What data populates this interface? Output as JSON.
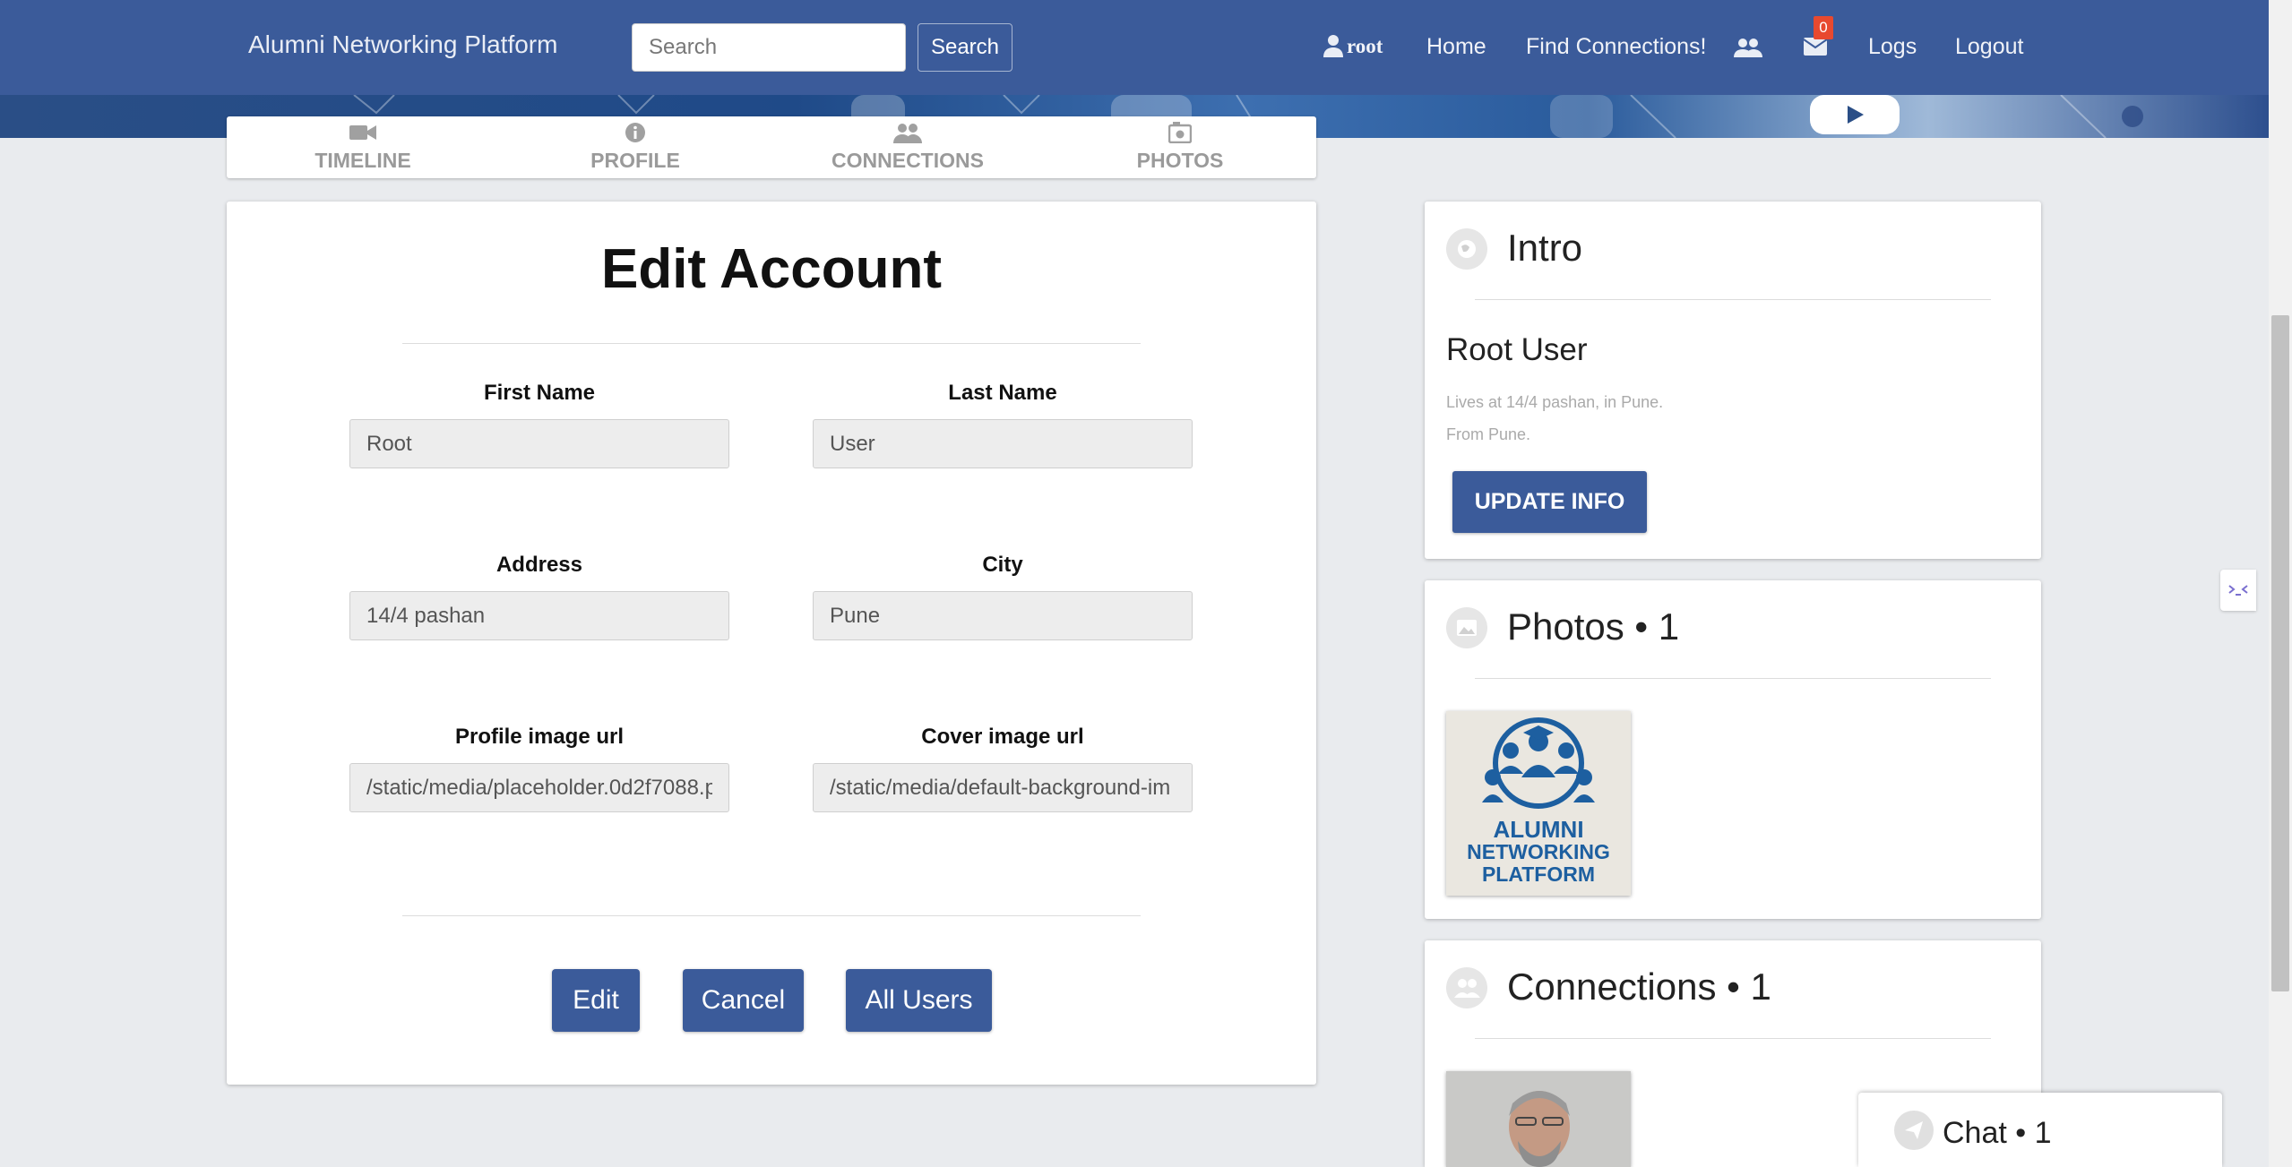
{
  "navbar": {
    "brand": "Alumni Networking Platform",
    "search_placeholder": "Search",
    "search_button": "Search",
    "user": "root",
    "home": "Home",
    "find": "Find Connections!",
    "messages_count": "0",
    "logs": "Logs",
    "logout": "Logout"
  },
  "tabs": [
    {
      "label": "TIMELINE",
      "icon": "video-camera-icon"
    },
    {
      "label": "PROFILE",
      "icon": "info-icon"
    },
    {
      "label": "CONNECTIONS",
      "icon": "users-icon"
    },
    {
      "label": "PHOTOS",
      "icon": "camera-icon"
    }
  ],
  "edit": {
    "title": "Edit Account",
    "first_name_label": "First Name",
    "first_name_value": "Root",
    "last_name_label": "Last Name",
    "last_name_value": "User",
    "address_label": "Address",
    "address_value": "14/4 pashan",
    "city_label": "City",
    "city_value": "Pune",
    "profile_url_label": "Profile image url",
    "profile_url_value": "/static/media/placeholder.0d2f7088.p",
    "cover_url_label": "Cover image url",
    "cover_url_value": "/static/media/default-background-im",
    "edit_button": "Edit",
    "cancel_button": "Cancel",
    "all_users_button": "All Users"
  },
  "intro": {
    "title": "Intro",
    "name": "Root User",
    "lives": "Lives at 14/4 pashan, in Pune.",
    "from": "From Pune.",
    "update_button": "UPDATE INFO"
  },
  "photos": {
    "title": "Photos • 1",
    "logo_text": [
      "ALUMNI",
      "NETWORKING",
      "PLATFORM"
    ]
  },
  "connections": {
    "title": "Connections • 1"
  },
  "chat": {
    "title": "Chat • 1"
  },
  "colors": {
    "primary": "#3b5b9a",
    "badge": "#e8492f",
    "background": "#e9ebee"
  }
}
